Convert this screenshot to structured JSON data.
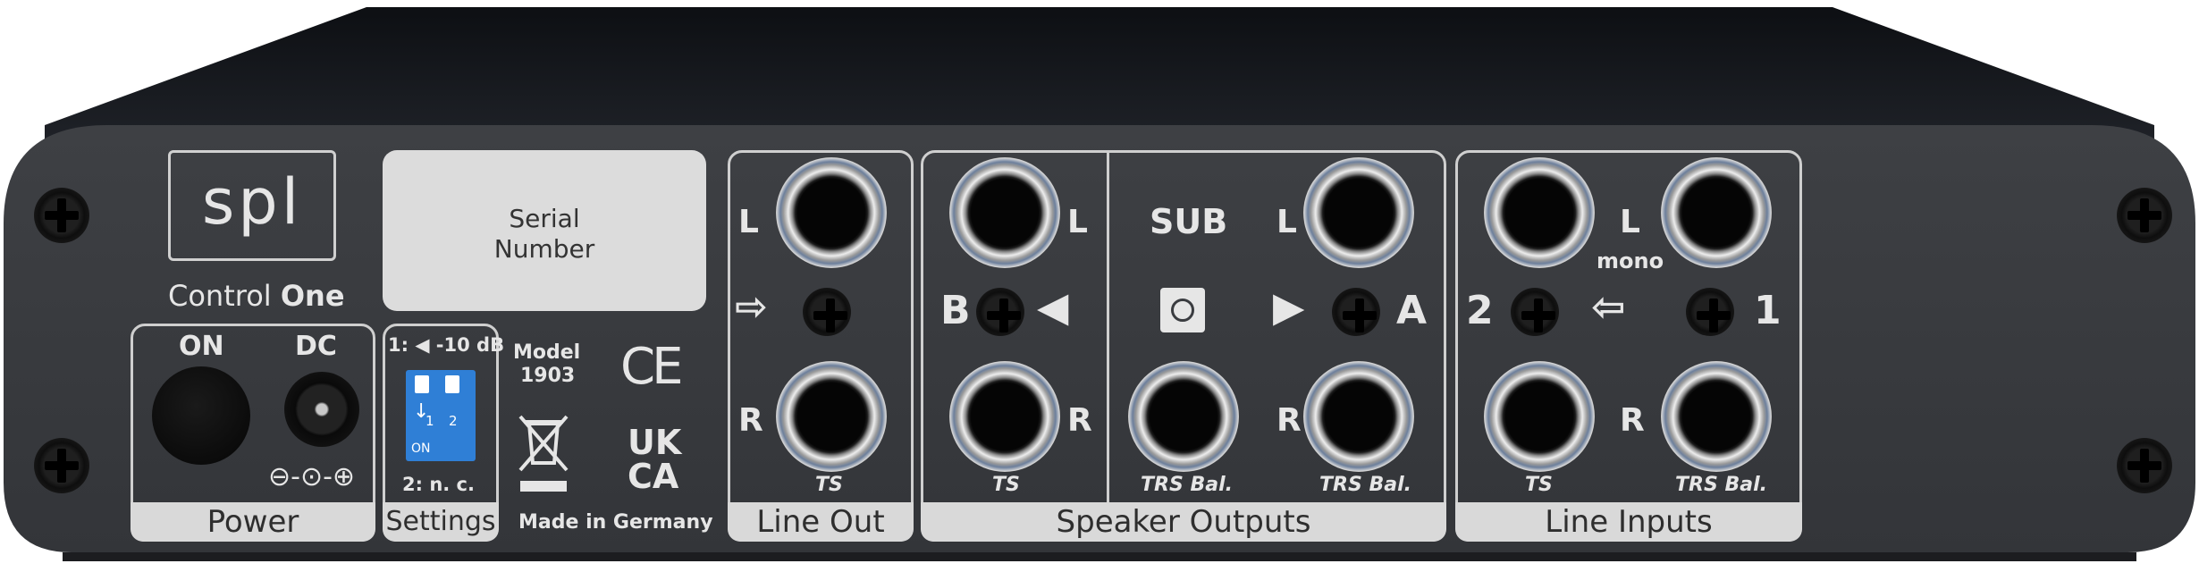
{
  "brand": {
    "logo": "spl",
    "model_prefix": "Control",
    "model_suffix": "One"
  },
  "serial": {
    "line1": "Serial",
    "line2": "Number"
  },
  "power": {
    "on_label": "ON",
    "dc_label": "DC",
    "polarity": "⊖-⊙-⊕",
    "section": "Power"
  },
  "settings": {
    "top_prefix": "1:",
    "top_value": "-10 dB",
    "switch_labels": [
      "1",
      "2"
    ],
    "switch_on": "ON",
    "bottom": "2: n. c.",
    "section": "Settings"
  },
  "model": {
    "line1": "Model",
    "line2": "1903",
    "ce": "CE",
    "ukca_line1": "UK",
    "ukca_line2": "CA",
    "made_in": "Made in Germany"
  },
  "line_out": {
    "left": "L",
    "right": "R",
    "type": "TS",
    "section": "Line Out"
  },
  "speaker_outputs": {
    "b_left": "L",
    "b_right": "R",
    "b_label": "B",
    "b_type": "TS",
    "sub_label": "SUB",
    "sub_type": "TRS Bal.",
    "a_left": "L",
    "a_right": "R",
    "a_label": "A",
    "a_type": "TRS Bal.",
    "section": "Speaker Outputs"
  },
  "line_inputs": {
    "left1": "L",
    "mono": "mono",
    "input2": "2",
    "input1": "1",
    "right": "R",
    "type2": "TS",
    "type1": "TRS Bal.",
    "section": "Line Inputs"
  },
  "colors": {
    "chassis": "#16181c",
    "panel": "#3a3c40",
    "label_bg": "#d9d9d9",
    "dip_switch": "#2f7fd6"
  }
}
